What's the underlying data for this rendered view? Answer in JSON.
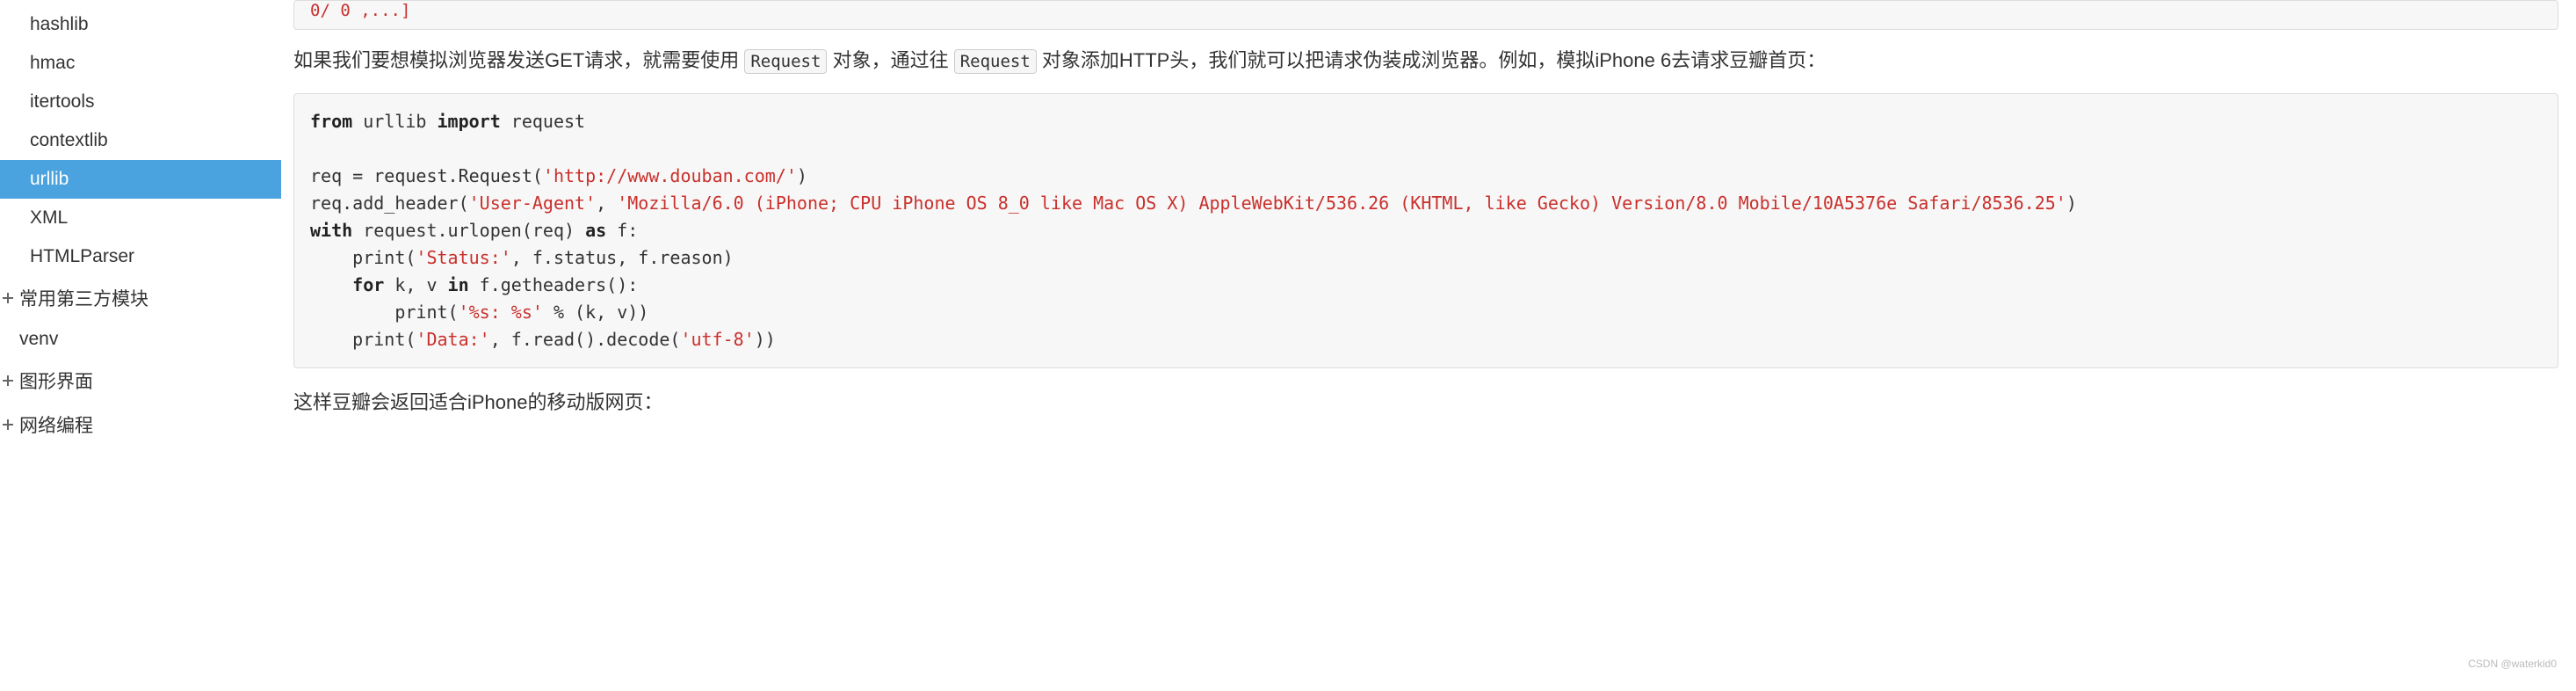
{
  "sidebar": {
    "items": [
      {
        "label": "hashlib",
        "active": false
      },
      {
        "label": "hmac",
        "active": false
      },
      {
        "label": "itertools",
        "active": false
      },
      {
        "label": "contextlib",
        "active": false
      },
      {
        "label": "urllib",
        "active": true
      },
      {
        "label": "XML",
        "active": false
      },
      {
        "label": "HTMLParser",
        "active": false
      }
    ],
    "sections": [
      {
        "label": "常用第三方模块"
      },
      {
        "label": "venv"
      },
      {
        "label": "图形界面"
      },
      {
        "label": "网络编程"
      }
    ]
  },
  "content": {
    "topcode_tail": "0/ 0 ,...]",
    "para1_pre": "如果我们要想模拟浏览器发送GET请求，就需要使用",
    "code_request1": "Request",
    "para1_mid": "对象，通过往",
    "code_request2": "Request",
    "para1_post": "对象添加HTTP头，我们就可以把请求伪装成浏览器。例如，模拟iPhone 6去请求豆瓣首页：",
    "code": {
      "line1_kw1": "from",
      "line1_mod": " urllib ",
      "line1_kw2": "import",
      "line1_mod2": " request",
      "line2_pre": "req = request.Request(",
      "line2_str": "'http://www.douban.com/'",
      "line2_post": ")",
      "line3_pre": "req.add_header(",
      "line3_str1": "'User-Agent'",
      "line3_mid": ", ",
      "line3_str2": "'Mozilla/6.0 (iPhone; CPU iPhone OS 8_0 like Mac OS X) AppleWebKit/536.26 (KHTML, like Gecko) Version/8.0 Mobile/10A5376e Safari/8536.25'",
      "line3_post": ")",
      "line4_kw": "with",
      "line4_mid": " request.urlopen(req) ",
      "line4_kw2": "as",
      "line4_post": " f:",
      "line5_pre": "    print(",
      "line5_str": "'Status:'",
      "line5_post": ", f.status, f.reason)",
      "line6_pre": "    ",
      "line6_kw": "for",
      "line6_mid": " k, v ",
      "line6_kw2": "in",
      "line6_post": " f.getheaders():",
      "line7_pre": "        print(",
      "line7_str": "'%s: %s'",
      "line7_post": " % (k, v))",
      "line8_pre": "    print(",
      "line8_str": "'Data:'",
      "line8_mid": ", f.read().decode(",
      "line8_str2": "'utf-8'",
      "line8_post": "))"
    },
    "para2": "这样豆瓣会返回适合iPhone的移动版网页："
  },
  "watermark": "CSDN @waterkid0"
}
